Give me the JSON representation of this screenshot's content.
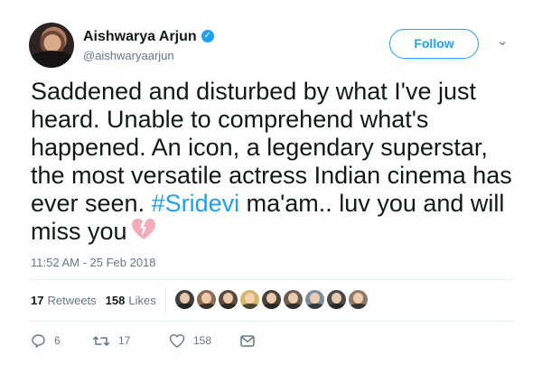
{
  "colors": {
    "accent": "#1da1f2",
    "text": "#14171a",
    "secondary": "#657786",
    "divider": "#e6ecf0",
    "broken_heart": "#f4abba"
  },
  "profile": {
    "display_name": "Aishwarya Arjun",
    "handle": "@aishwaryaarjun",
    "verified_icon": "verified-badge-icon"
  },
  "actions_top": {
    "follow_label": "Follow",
    "menu_icon": "chevron-down-icon"
  },
  "tweet": {
    "text_before_hashtag": "Saddened and disturbed by what I've just heard. Unable to comprehend what's happened. An icon, a legendary superstar, the most versatile actress Indian cinema has ever seen. ",
    "hashtag": "#Sridevi",
    "text_after_hashtag": " ma'am.. luv you and will miss you",
    "emoji": "broken-heart-icon",
    "timestamp": "11:52 AM - 25 Feb 2018"
  },
  "stats": {
    "retweets_count": "17",
    "retweets_label": "Retweets",
    "likes_count": "158",
    "likes_label": "Likes"
  },
  "liked_by": {
    "avatars": [
      {
        "name": "liked-user-avatar-1",
        "bg": "#3b3d3f"
      },
      {
        "name": "liked-user-avatar-2",
        "bg": "#8d6b55"
      },
      {
        "name": "liked-user-avatar-3",
        "bg": "#5a4a3e"
      },
      {
        "name": "liked-user-avatar-4",
        "bg": "#d4b66b"
      },
      {
        "name": "liked-user-avatar-5",
        "bg": "#4d4039"
      },
      {
        "name": "liked-user-avatar-6",
        "bg": "#6b5b4e"
      },
      {
        "name": "liked-user-avatar-7",
        "bg": "#7a8f9b"
      },
      {
        "name": "liked-user-avatar-8",
        "bg": "#4a4a4a"
      },
      {
        "name": "liked-user-avatar-9",
        "bg": "#8f7869"
      }
    ]
  },
  "footer_actions": {
    "reply_count": "6",
    "retweet_count": "17",
    "like_count": "158",
    "reply_icon": "reply-icon",
    "retweet_icon": "retweet-icon",
    "like_icon": "heart-icon",
    "message_icon": "envelope-icon"
  }
}
